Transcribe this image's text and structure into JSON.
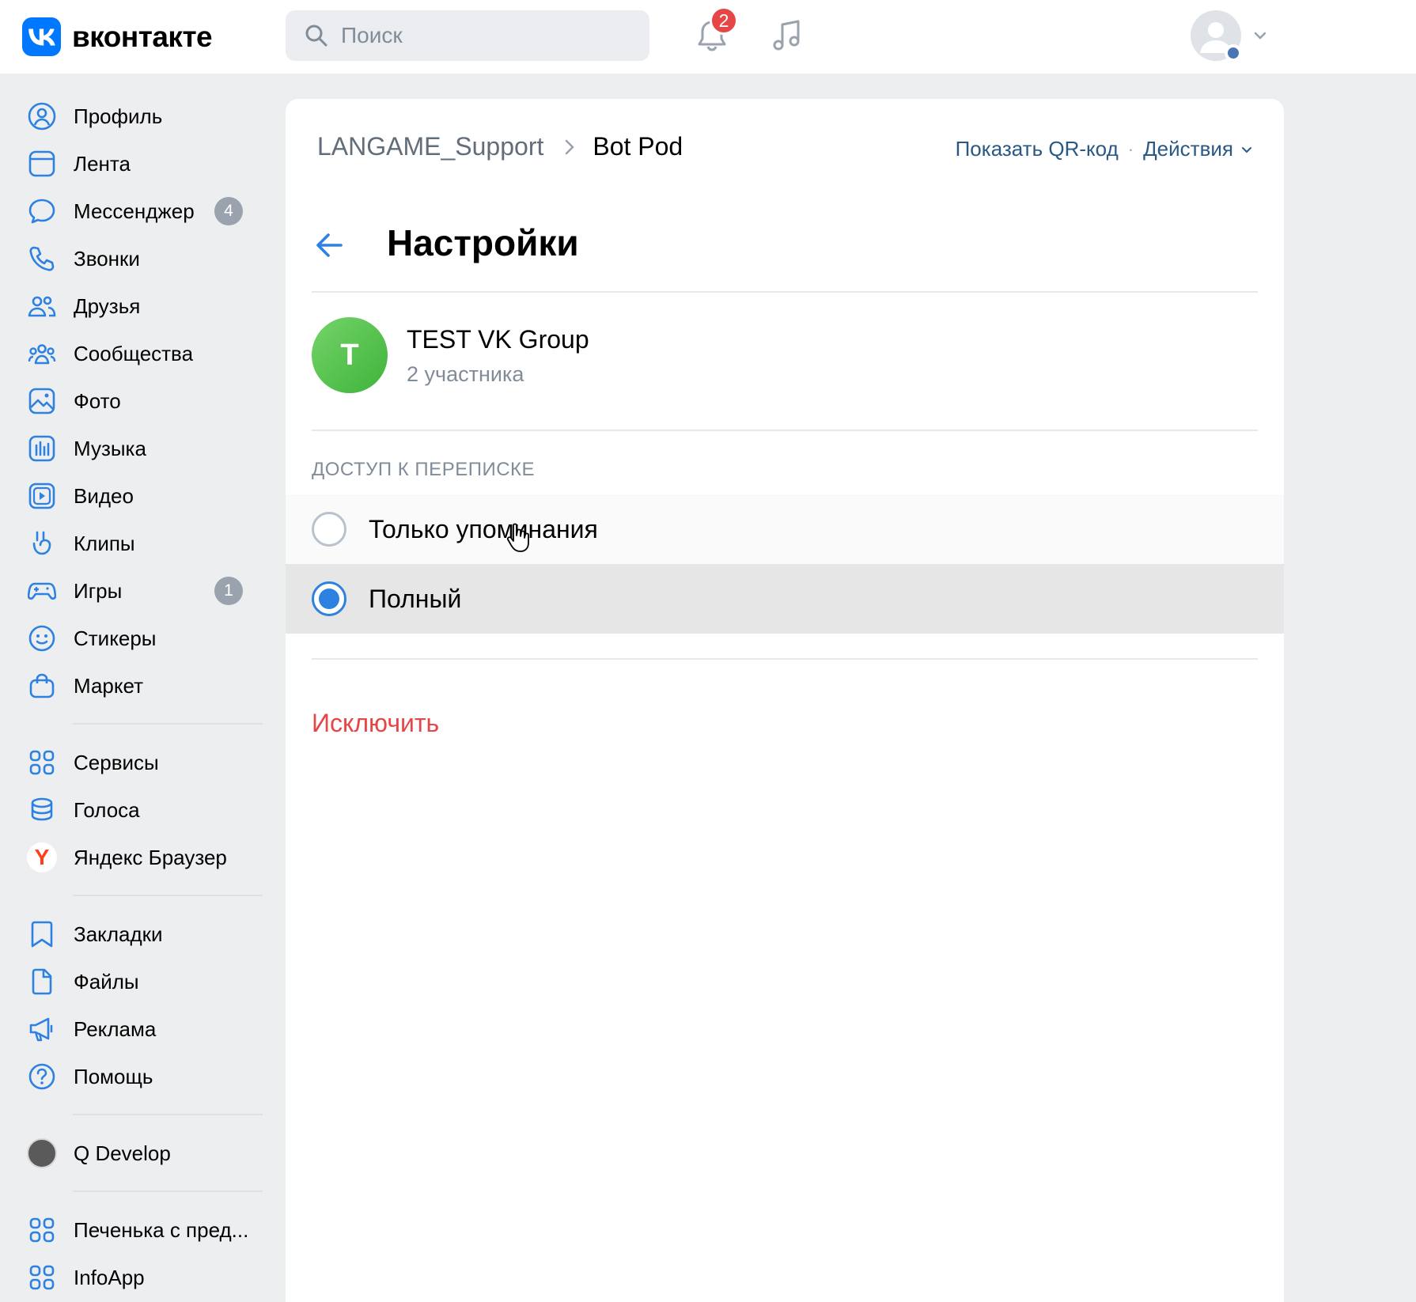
{
  "app": {
    "logo_text": "вконтакте",
    "brand_color": "#0077ff"
  },
  "topbar": {
    "search_placeholder": "Поиск",
    "notifications_count": "2"
  },
  "sidebar": {
    "items": [
      {
        "label": "Профиль",
        "icon": "user-circle-icon"
      },
      {
        "label": "Лента",
        "icon": "feed-icon"
      },
      {
        "label": "Мессенджер",
        "icon": "message-icon",
        "badge": "4"
      },
      {
        "label": "Звонки",
        "icon": "phone-icon"
      },
      {
        "label": "Друзья",
        "icon": "friends-icon"
      },
      {
        "label": "Сообщества",
        "icon": "communities-icon"
      },
      {
        "label": "Фото",
        "icon": "photo-icon"
      },
      {
        "label": "Музыка",
        "icon": "music-icon"
      },
      {
        "label": "Видео",
        "icon": "video-icon"
      },
      {
        "label": "Клипы",
        "icon": "clips-icon"
      },
      {
        "label": "Игры",
        "icon": "gamepad-icon",
        "badge": "1"
      },
      {
        "label": "Стикеры",
        "icon": "smile-icon"
      },
      {
        "label": "Маркет",
        "icon": "market-icon"
      },
      {
        "label": "Сервисы",
        "icon": "services-icon"
      },
      {
        "label": "Голоса",
        "icon": "coins-icon"
      },
      {
        "label": "Яндекс Браузер",
        "icon": "yandex-icon"
      },
      {
        "label": "Закладки",
        "icon": "bookmark-icon"
      },
      {
        "label": "Файлы",
        "icon": "file-icon"
      },
      {
        "label": "Реклама",
        "icon": "megaphone-icon"
      },
      {
        "label": "Помощь",
        "icon": "help-icon"
      },
      {
        "label": "Q Develop",
        "icon": "qdevelop-avatar-icon"
      },
      {
        "label": "Печенька с пред...",
        "icon": "services-icon"
      },
      {
        "label": "InfoApp",
        "icon": "services-icon"
      }
    ]
  },
  "main": {
    "breadcrumb": {
      "parent": "LANGAME_Support",
      "current": "Bot Pod"
    },
    "actions": {
      "qr": "Показать QR-код",
      "separator": "·",
      "menu": "Действия"
    },
    "title": "Настройки",
    "group": {
      "initial": "T",
      "name": "TEST VK Group",
      "members": "2 участника"
    },
    "access": {
      "section_title": "ДОСТУП К ПЕРЕПИСКЕ",
      "options": [
        {
          "label": "Только упоминания",
          "checked": false
        },
        {
          "label": "Полный",
          "checked": true
        }
      ]
    },
    "exclude_label": "Исключить"
  }
}
